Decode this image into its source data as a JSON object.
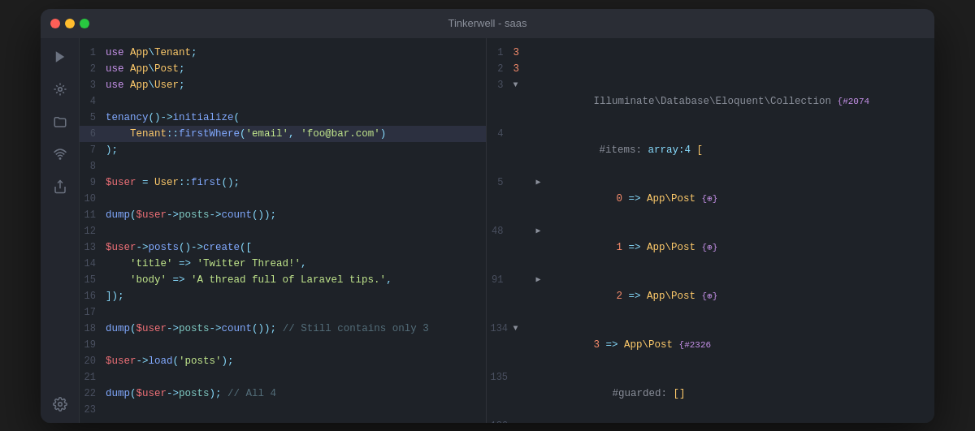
{
  "window": {
    "title": "Tinkerwell - saas"
  },
  "sidebar": {
    "icons": [
      {
        "name": "play-icon",
        "symbol": "▶",
        "active": false
      },
      {
        "name": "tinkerwell-icon",
        "symbol": "🔧",
        "active": false
      },
      {
        "name": "folder-icon",
        "symbol": "🗂",
        "active": false
      },
      {
        "name": "wifi-icon",
        "symbol": "📡",
        "active": false
      },
      {
        "name": "share-icon",
        "symbol": "↗",
        "active": false
      },
      {
        "name": "settings-icon",
        "symbol": "⚙",
        "active": false
      }
    ]
  },
  "code": {
    "lines": [
      {
        "num": 1,
        "content": "use App\\Tenant;",
        "highlighted": false
      },
      {
        "num": 2,
        "content": "use App\\Post;",
        "highlighted": false
      },
      {
        "num": 3,
        "content": "use App\\User;",
        "highlighted": false
      },
      {
        "num": 4,
        "content": "",
        "highlighted": false
      },
      {
        "num": 5,
        "content": "tenancy()->initialize(",
        "highlighted": false
      },
      {
        "num": 6,
        "content": "    Tenant::firstWhere('email', 'foo@bar.com')",
        "highlighted": true
      },
      {
        "num": 7,
        "content": ");",
        "highlighted": false
      },
      {
        "num": 8,
        "content": "",
        "highlighted": false
      },
      {
        "num": 9,
        "content": "$user = User::first();",
        "highlighted": false
      },
      {
        "num": 10,
        "content": "",
        "highlighted": false
      },
      {
        "num": 11,
        "content": "dump($user->posts->count());",
        "highlighted": false
      },
      {
        "num": 12,
        "content": "",
        "highlighted": false
      },
      {
        "num": 13,
        "content": "$user->posts()->create([",
        "highlighted": false
      },
      {
        "num": 14,
        "content": "    'title' => 'Twitter Thread!',",
        "highlighted": false
      },
      {
        "num": 15,
        "content": "    'body' => 'A thread full of Laravel tips.',",
        "highlighted": false
      },
      {
        "num": 16,
        "content": "]);",
        "highlighted": false
      },
      {
        "num": 17,
        "content": "",
        "highlighted": false
      },
      {
        "num": 18,
        "content": "dump($user->posts->count()); // Still contains only 3",
        "highlighted": false
      },
      {
        "num": 19,
        "content": "",
        "highlighted": false
      },
      {
        "num": 20,
        "content": "$user->load('posts');",
        "highlighted": false
      },
      {
        "num": 21,
        "content": "",
        "highlighted": false
      },
      {
        "num": 22,
        "content": "dump($user->posts); // All 4",
        "highlighted": false
      },
      {
        "num": 23,
        "content": "",
        "highlighted": false
      }
    ]
  },
  "output": {
    "title": "Tinkerwell - saas"
  }
}
